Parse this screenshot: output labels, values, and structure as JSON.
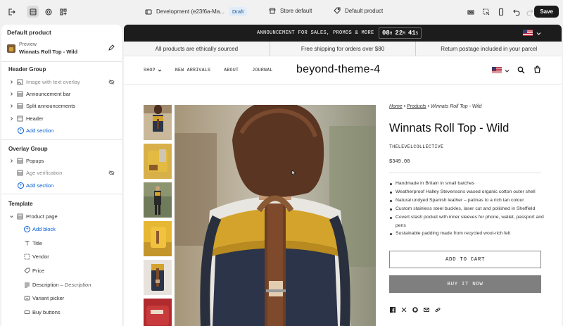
{
  "topbar": {
    "theme_name": "Development (e23f6a-Ma...",
    "status_badge": "Draft",
    "store_label": "Store default",
    "template_label": "Default product",
    "save_label": "Save"
  },
  "sidebar": {
    "title": "Default product",
    "preview_label": "Preview",
    "preview_value": "Winnats Roll Top - Wild",
    "header_group": {
      "title": "Header Group",
      "items": [
        {
          "label": "Image with text overlay"
        },
        {
          "label": "Announcement bar"
        },
        {
          "label": "Split announcements"
        },
        {
          "label": "Header"
        }
      ],
      "add_label": "Add section"
    },
    "overlay_group": {
      "title": "Overlay Group",
      "items": [
        {
          "label": "Popups"
        },
        {
          "label": "Age verification"
        }
      ],
      "add_label": "Add section"
    },
    "template": {
      "title": "Template",
      "section_label": "Product page",
      "add_block_label": "Add block",
      "blocks": [
        {
          "label": "Title"
        },
        {
          "label": "Vendor"
        },
        {
          "label": "Price"
        },
        {
          "label": "Description",
          "suffix": "– Description"
        },
        {
          "label": "Variant picker"
        },
        {
          "label": "Buy buttons"
        }
      ]
    }
  },
  "store": {
    "announcement": "ANNOUNCEMENT FOR SALES, PROMOS & MORE",
    "countdown": {
      "hours": "08",
      "h": "H",
      "minutes": "22",
      "m": "M",
      "seconds": "41",
      "s": "S"
    },
    "info": [
      "All products are ethically sourced",
      "Free shipping for orders over $80",
      "Return postage included in your parcel"
    ],
    "nav": [
      "SHOP",
      "NEW ARRIVALS",
      "ABOUT",
      "JOURNAL"
    ],
    "logo": "beyond-theme-4",
    "product": {
      "breadcrumb": {
        "home": "Home",
        "sep": "•",
        "products": "Products",
        "current": "Winnats Roll Top - Wild"
      },
      "title": "Winnats Roll Top - Wild",
      "vendor": "THELEVELCOLLECTIVE",
      "price": "$349.00",
      "features": [
        "Handmade in Britain in small batches",
        "Weatherproof Halley Stevensons waxed organic cotton outer shell",
        "Natural undyed Spanish leather – patinas to a rich tan colour",
        "Custom stainless steel buckles, laser cut and polished in Sheffield",
        "Covert stash pocket with inner sleeves for phone, wallet, passport and pens",
        "Sustainable padding made from recycled wool-rich felt"
      ],
      "add_to_cart": "ADD TO CART",
      "buy_now": "BUY IT NOW"
    }
  },
  "colors": {
    "accent": "#005bd3",
    "save_bg": "#1a1a1a",
    "announcement_bg": "#1c1c1c",
    "buy_now_bg": "#7f7f7f",
    "bag_yellow": "#d4a32b",
    "bag_navy": "#2b3448"
  },
  "icons": {
    "share": [
      "facebook-icon",
      "x-icon",
      "pinterest-icon",
      "email-icon",
      "link-icon"
    ]
  }
}
